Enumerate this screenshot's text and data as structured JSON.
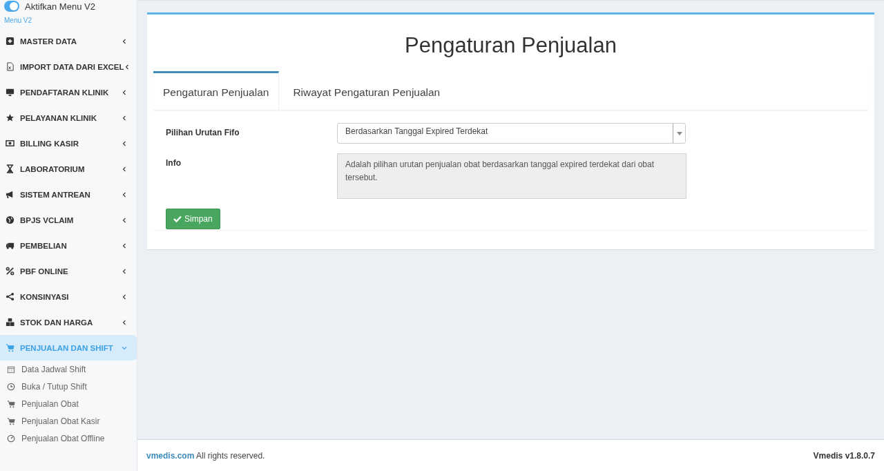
{
  "sidebar": {
    "toggle": {
      "label": "Aktifkan Menu V2",
      "on": true
    },
    "section_label": "Menu V2",
    "items": [
      {
        "label": "MASTER DATA",
        "selected": false,
        "expanded": false
      },
      {
        "label": "IMPORT DATA DARI EXCEL",
        "selected": false,
        "expanded": false
      },
      {
        "label": "PENDAFTARAN KLINIK",
        "selected": false,
        "expanded": false
      },
      {
        "label": "PELAYANAN KLINIK",
        "selected": false,
        "expanded": false
      },
      {
        "label": "BILLING KASIR",
        "selected": false,
        "expanded": false
      },
      {
        "label": "LABORATORIUM",
        "selected": false,
        "expanded": false
      },
      {
        "label": "SISTEM ANTREAN",
        "selected": false,
        "expanded": false
      },
      {
        "label": "BPJS VCLAIM",
        "selected": false,
        "expanded": false
      },
      {
        "label": "PEMBELIAN",
        "selected": false,
        "expanded": false
      },
      {
        "label": "PBF ONLINE",
        "selected": false,
        "expanded": false
      },
      {
        "label": "KONSINYASI",
        "selected": false,
        "expanded": false
      },
      {
        "label": "STOK DAN HARGA",
        "selected": false,
        "expanded": false
      },
      {
        "label": "PENJUALAN DAN SHIFT",
        "selected": true,
        "expanded": true,
        "children": [
          {
            "label": "Data Jadwal Shift"
          },
          {
            "label": "Buka / Tutup Shift"
          },
          {
            "label": "Penjualan Obat"
          },
          {
            "label": "Penjualan Obat Kasir"
          },
          {
            "label": "Penjualan Obat Offline"
          }
        ]
      }
    ]
  },
  "page": {
    "title": "Pengaturan Penjualan",
    "tabs": [
      {
        "label": "Pengaturan Penjualan",
        "selected": true
      },
      {
        "label": "Riwayat Pengaturan Penjualan",
        "selected": false
      }
    ],
    "form": {
      "fields": [
        {
          "label": "Pilihan Urutan Fifo",
          "kind": "select",
          "value": "Berdasarkan Tanggal Expired Terdekat"
        },
        {
          "label": "Info",
          "kind": "textarea",
          "value": "Adalah pilihan urutan penjualan obat berdasarkan tanggal expired terdekat dari obat tersebut."
        }
      ],
      "submit": "Simpan"
    }
  },
  "footer": {
    "link": "vmedis.com",
    "text": "All rights reserved.",
    "version": "Vmedis v1.8.0.7"
  }
}
